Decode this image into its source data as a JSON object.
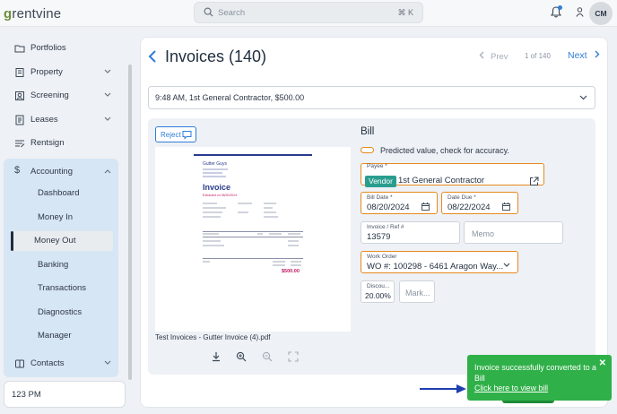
{
  "app": {
    "logo_text": "rentvine",
    "logo_mark": "g"
  },
  "search": {
    "placeholder": "Search",
    "shortcut": "⌘ K"
  },
  "user": {
    "initials": "CM"
  },
  "sidebar": {
    "items": [
      {
        "label": "Portfolios",
        "icon": "folder-icon"
      },
      {
        "label": "Property",
        "icon": "building-icon",
        "has_chevron": true
      },
      {
        "label": "Screening",
        "icon": "screening-icon",
        "has_chevron": true
      },
      {
        "label": "Leases",
        "icon": "lease-icon",
        "has_chevron": true
      },
      {
        "label": "Rentsign",
        "icon": "rentsign-icon"
      },
      {
        "label": "Accounting",
        "icon": "dollar-icon",
        "expanded": true
      },
      {
        "label": "Contacts",
        "icon": "contacts-icon",
        "has_chevron": true
      }
    ],
    "accounting_sub": [
      "Dashboard",
      "Money In",
      "Money Out",
      "Banking",
      "Transactions",
      "Diagnostics",
      "Manager"
    ],
    "active_sub": "Money Out",
    "footer_text": "123 PM"
  },
  "header": {
    "title": "Invoices (140)",
    "prev": "Prev",
    "position": "1 of 140",
    "next": "Next"
  },
  "invoice_selector": {
    "value": "9:48 AM, 1st General Contractor, $500.00"
  },
  "preview": {
    "reject_label": "Reject",
    "company": "Gutter Guys",
    "doc_title": "Invoice",
    "doc_date": "Extracted on 08/20/2024",
    "total": "$500.00",
    "filename": "Test Invoices - Gutter Invoice (4).pdf"
  },
  "bill": {
    "heading": "Bill",
    "predicted_note": "Predicted value, check for accuracy.",
    "payee_label": "Payee *",
    "payee_tag": "Vendor",
    "payee_value": "1st General Contractor",
    "bill_date_label": "Bill Date *",
    "bill_date": "08/20/2024",
    "date_due_label": "Date Due *",
    "date_due": "08/22/2024",
    "invoice_ref_label": "Invoice / Ref #",
    "invoice_ref": "13579",
    "memo_placeholder": "Memo",
    "work_order_label": "Work Order",
    "work_order": "WO #: 100298 - 6461 Aragon Way...",
    "discount_label": "Discou...",
    "discount_value": "20.00%",
    "markup_placeholder": "Mark..."
  },
  "toast": {
    "message": "Invoice successfully converted to a Bill",
    "link": "Click here to view bill"
  },
  "colors": {
    "accent": "#2f7dd8",
    "predicted": "#e58a1f",
    "success": "#2fb048",
    "vendor_tag": "#2a9d8f",
    "invoice_total": "#c0185f"
  }
}
